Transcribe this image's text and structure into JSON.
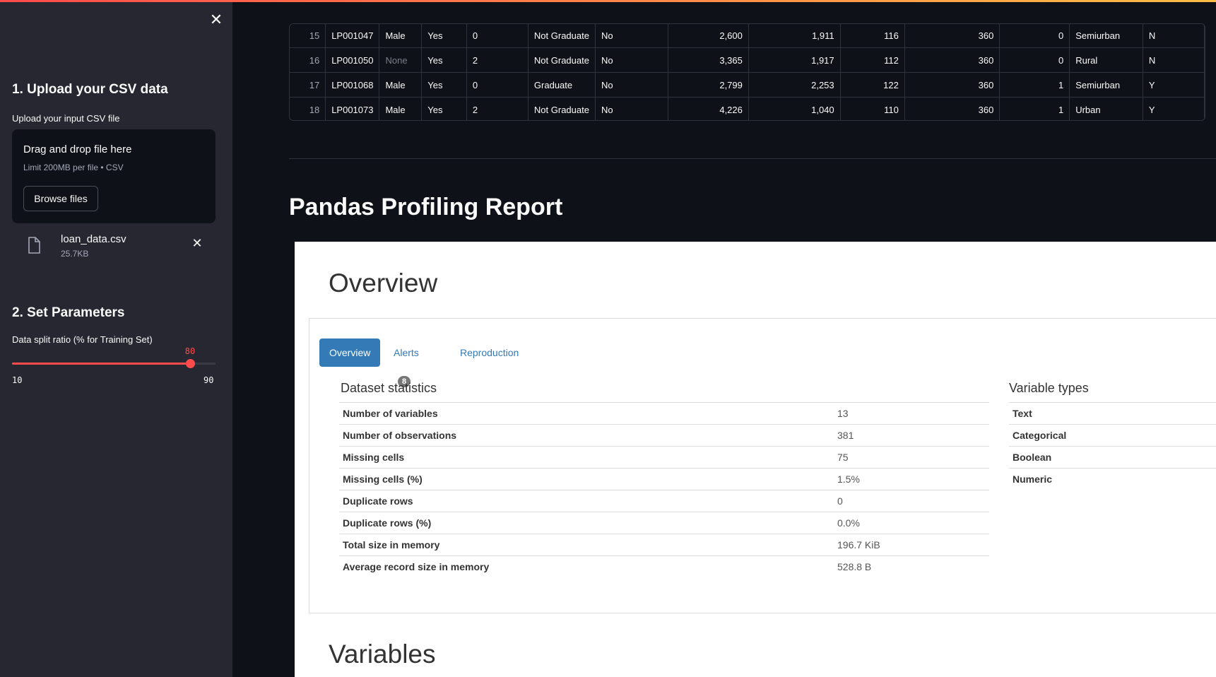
{
  "sidebar": {
    "section1_title": "1. Upload your CSV data",
    "upload_label": "Upload your input CSV file",
    "dropzone": {
      "title": "Drag and drop file here",
      "limit": "Limit 200MB per file • CSV",
      "browse_label": "Browse files"
    },
    "file": {
      "name": "loan_data.csv",
      "size": "25.7KB"
    },
    "section2_title": "2. Set Parameters",
    "slider": {
      "label": "Data split ratio (% for Training Set)",
      "value": "80",
      "min": "10",
      "max": "90"
    }
  },
  "data_table": {
    "rows": [
      [
        "15",
        "LP001047",
        "Male",
        "Yes",
        "0",
        "Not Graduate",
        "No",
        "2,600",
        "1,911",
        "116",
        "360",
        "0",
        "Semiurban",
        "N"
      ],
      [
        "16",
        "LP001050",
        "None",
        "Yes",
        "2",
        "Not Graduate",
        "No",
        "3,365",
        "1,917",
        "112",
        "360",
        "0",
        "Rural",
        "N"
      ],
      [
        "17",
        "LP001068",
        "Male",
        "Yes",
        "0",
        "Graduate",
        "No",
        "2,799",
        "2,253",
        "122",
        "360",
        "1",
        "Semiurban",
        "Y"
      ],
      [
        "18",
        "LP001073",
        "Male",
        "Yes",
        "2",
        "Not Graduate",
        "No",
        "4,226",
        "1,040",
        "110",
        "360",
        "1",
        "Urban",
        "Y"
      ]
    ]
  },
  "main": {
    "report_title": "Pandas Profiling Report"
  },
  "report": {
    "overview_heading": "Overview",
    "tabs": {
      "overview": "Overview",
      "alerts": "Alerts",
      "alerts_count": "8",
      "reproduction": "Reproduction"
    },
    "dataset_statistics": {
      "title": "Dataset statistics",
      "rows": [
        {
          "label": "Number of variables",
          "value": "13"
        },
        {
          "label": "Number of observations",
          "value": "381"
        },
        {
          "label": "Missing cells",
          "value": "75"
        },
        {
          "label": "Missing cells (%)",
          "value": "1.5%"
        },
        {
          "label": "Duplicate rows",
          "value": "0"
        },
        {
          "label": "Duplicate rows (%)",
          "value": "0.0%"
        },
        {
          "label": "Total size in memory",
          "value": "196.7 KiB"
        },
        {
          "label": "Average record size in memory",
          "value": "528.8 B"
        }
      ]
    },
    "variable_types": {
      "title": "Variable types",
      "rows": [
        "Text",
        "Categorical",
        "Boolean",
        "Numeric"
      ]
    },
    "variables_heading": "Variables"
  },
  "colors": {
    "accent": "#ff4b4b",
    "sidebar_bg": "#262730",
    "app_bg": "#0e1117",
    "link": "#337ab7"
  }
}
